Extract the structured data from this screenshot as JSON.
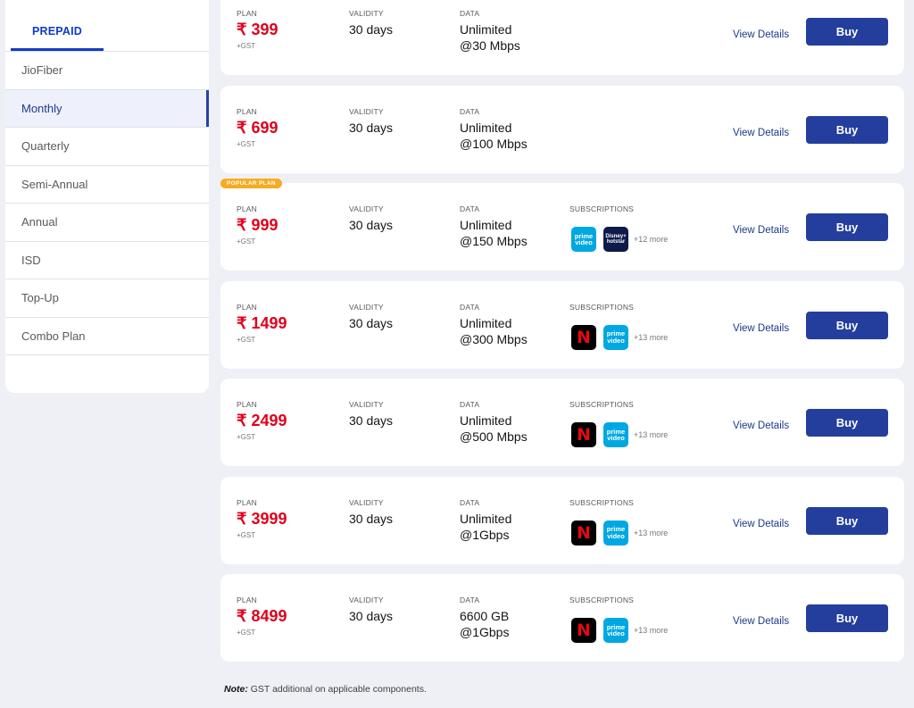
{
  "sidebar": {
    "tab": "PREPAID",
    "items": [
      "JioFiber",
      "Monthly",
      "Quarterly",
      "Semi-Annual",
      "Annual",
      "ISD",
      "Top-Up",
      "Combo Plan"
    ],
    "active": "Monthly"
  },
  "labels": {
    "plan": "PLAN",
    "validity": "VALIDITY",
    "data": "DATA",
    "subscriptions": "SUBSCRIPTIONS",
    "gst": "+GST",
    "view_details": "View Details",
    "buy": "Buy",
    "popular": "POPULAR PLAN"
  },
  "plans": [
    {
      "price": "₹ 399",
      "validity": "30 days",
      "data1": "Unlimited",
      "data2": "@30 Mbps",
      "subs": [],
      "more": ""
    },
    {
      "price": "₹ 699",
      "validity": "30 days",
      "data1": "Unlimited",
      "data2": "@100 Mbps",
      "subs": [],
      "more": ""
    },
    {
      "price": "₹ 999",
      "validity": "30 days",
      "data1": "Unlimited",
      "data2": "@150 Mbps",
      "subs": [
        "prime-video",
        "disney-hotstar"
      ],
      "more": "+12 more",
      "popular": true
    },
    {
      "price": "₹ 1499",
      "validity": "30 days",
      "data1": "Unlimited",
      "data2": "@300 Mbps",
      "subs": [
        "netflix",
        "prime-video"
      ],
      "more": "+13 more"
    },
    {
      "price": "₹ 2499",
      "validity": "30 days",
      "data1": "Unlimited",
      "data2": "@500 Mbps",
      "subs": [
        "netflix",
        "prime-video"
      ],
      "more": "+13 more"
    },
    {
      "price": "₹ 3999",
      "validity": "30 days",
      "data1": "Unlimited",
      "data2": "@1Gbps",
      "subs": [
        "netflix",
        "prime-video"
      ],
      "more": "+13 more"
    },
    {
      "price": "₹ 8499",
      "validity": "30 days",
      "data1": "6600 GB",
      "data2": "@1Gbps",
      "subs": [
        "netflix",
        "prime-video"
      ],
      "more": "+13 more"
    }
  ],
  "note": {
    "label": "Note:",
    "text": " GST additional on applicable components."
  },
  "colors": {
    "accent": "#233e9c",
    "price": "#e0001b",
    "badge": "#f7ab20"
  }
}
